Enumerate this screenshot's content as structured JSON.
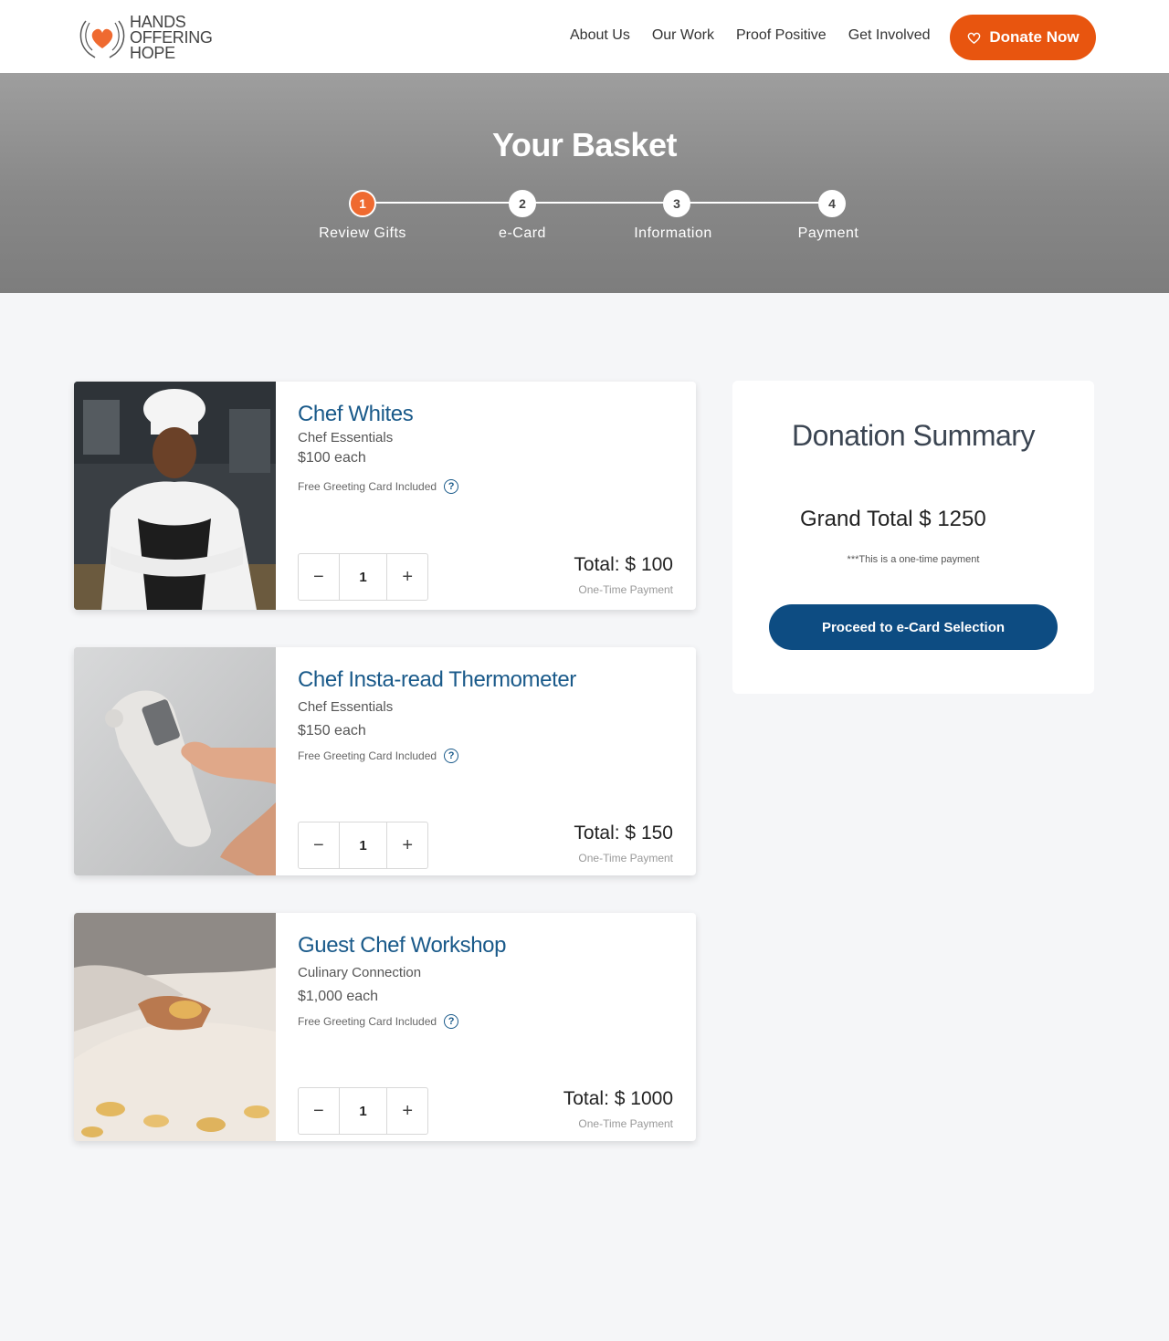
{
  "brand": {
    "logo_line1": "HANDS",
    "logo_line2": "OFFERING",
    "logo_line3": "HOPE",
    "accent": "#e8550f",
    "primary": "#0d4c82",
    "title_blue": "#1a5a8a"
  },
  "nav": {
    "items": [
      "About Us",
      "Our Work",
      "Proof Positive",
      "Get Involved"
    ],
    "donate_label": "Donate Now"
  },
  "hero": {
    "title": "Your Basket",
    "steps": [
      {
        "number": "1",
        "label": "Review Gifts",
        "active": true
      },
      {
        "number": "2",
        "label": "e-Card",
        "active": false
      },
      {
        "number": "3",
        "label": "Information",
        "active": false
      },
      {
        "number": "4",
        "label": "Payment",
        "active": false
      }
    ]
  },
  "basket": {
    "items": [
      {
        "title": "Chef Whites",
        "category": "Chef Essentials",
        "price": "$100 each",
        "greeting": "Free Greeting Card Included",
        "quantity": "1",
        "total": "Total: $ 100",
        "payment_note": "One-Time Payment",
        "image_icon": "chef-photo"
      },
      {
        "title": "Chef Insta-read Thermometer",
        "category": "Chef Essentials",
        "price": "$150 each",
        "greeting": "Free Greeting Card Included",
        "quantity": "1",
        "total": "Total: $ 150",
        "payment_note": "One-Time Payment",
        "image_icon": "thermometer-photo"
      },
      {
        "title": "Guest Chef Workshop",
        "category": "Culinary Connection",
        "price": "$1,000 each",
        "greeting": "Free Greeting Card Included",
        "quantity": "1",
        "total": "Total: $ 1000",
        "payment_note": "One-Time Payment",
        "image_icon": "pasta-photo"
      }
    ]
  },
  "summary": {
    "title": "Donation Summary",
    "grand_total": "Grand Total  $ 1250",
    "note": "***This is a one-time payment",
    "proceed_label": "Proceed to e-Card Selection"
  }
}
